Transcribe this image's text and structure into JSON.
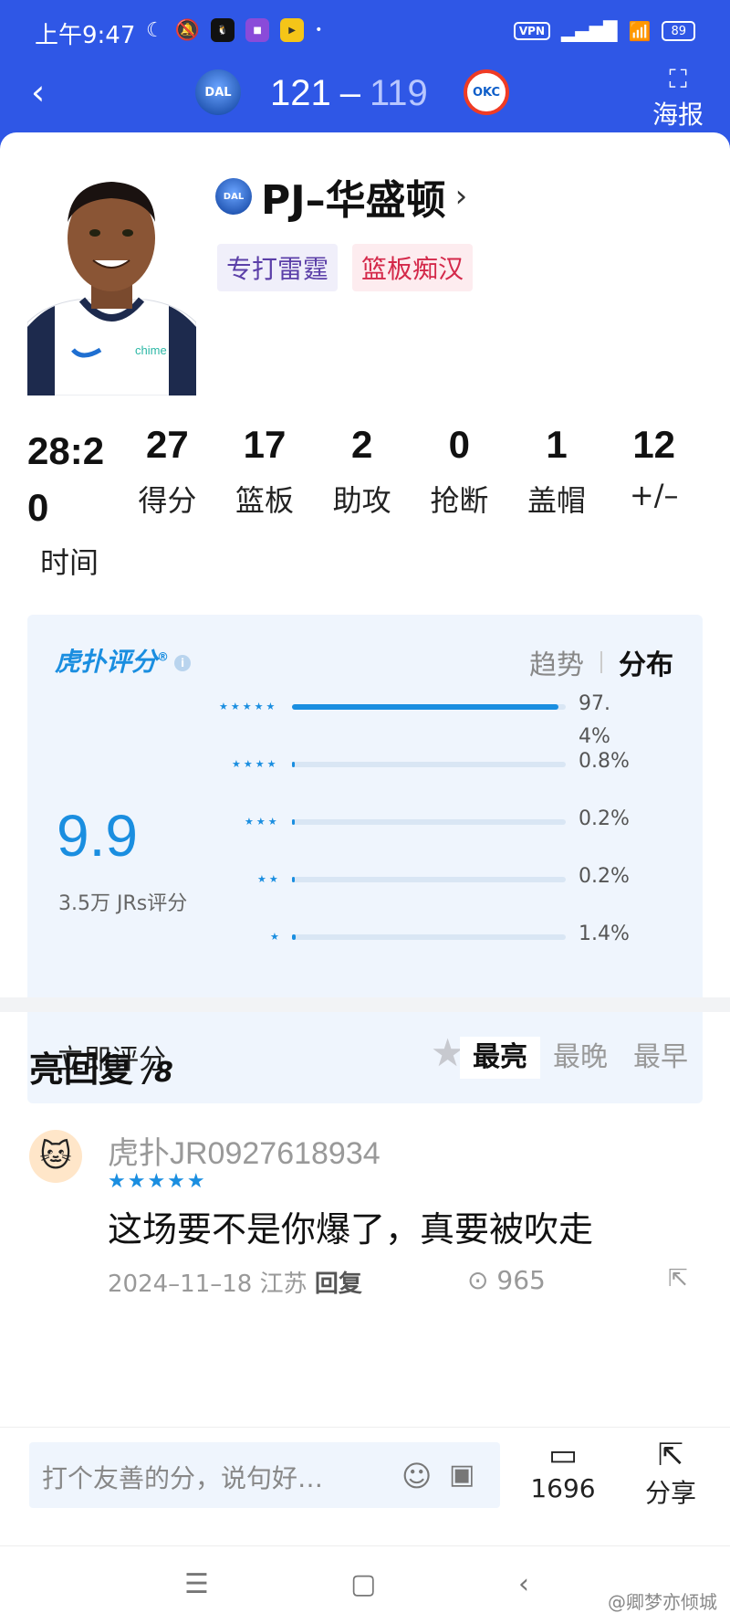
{
  "status_bar": {
    "time": "上午9:47",
    "icons": [
      "moon-icon",
      "mute-icon",
      "qq-icon",
      "app-icon",
      "video-app-icon",
      "dot"
    ],
    "vpn": "VPN",
    "signal": "HD",
    "battery": "89"
  },
  "header": {
    "home_team": "DAL",
    "away_team": "OKC",
    "home_score": "121",
    "separator": "–",
    "away_score": "119",
    "poster_label": "海报"
  },
  "player": {
    "name": "PJ–华盛顿",
    "team_abbr": "DAL",
    "tags": [
      "专打雷霆",
      "篮板痴汉"
    ]
  },
  "stats": [
    {
      "value": "28:20",
      "label": "时间"
    },
    {
      "value": "27",
      "label": "得分"
    },
    {
      "value": "17",
      "label": "篮板"
    },
    {
      "value": "2",
      "label": "助攻"
    },
    {
      "value": "0",
      "label": "抢断"
    },
    {
      "value": "1",
      "label": "盖帽"
    },
    {
      "value": "12",
      "label": "+/–"
    }
  ],
  "rating": {
    "brand": "虎扑评分",
    "brand_mark": "®",
    "tabs": {
      "trend": "趋势",
      "distribution": "分布"
    },
    "score": "9.9",
    "count_text": "3.5万 JRs评分",
    "distribution": [
      {
        "stars": "★★★★★",
        "percent": "97.4%",
        "fraction": 0.974
      },
      {
        "stars": "★★★★",
        "percent": "0.8%",
        "fraction": 0.008
      },
      {
        "stars": "★★★",
        "percent": "0.2%",
        "fraction": 0.002
      },
      {
        "stars": "★★",
        "percent": "0.2%",
        "fraction": 0.002
      },
      {
        "stars": "★",
        "percent": "1.4%",
        "fraction": 0.014
      }
    ],
    "rate_now_label": "立即评分",
    "accent_color": "#1a8ee0"
  },
  "comments": {
    "title": "亮回复",
    "count": "/8",
    "sort_tabs": [
      "最亮",
      "最晚",
      "最早"
    ],
    "items": [
      {
        "user": "虎扑JR0927618934",
        "stars": "★★★★★",
        "text": "这场要不是你爆了，真要被吹走",
        "date": "2024–11–18",
        "location": "江苏",
        "reply_label": "回复",
        "likes": "965"
      }
    ]
  },
  "composer": {
    "placeholder": "打个友善的分，说句好…",
    "comment_count": "1696",
    "share_label": "分享"
  },
  "watermark": "@卿梦亦倾城"
}
